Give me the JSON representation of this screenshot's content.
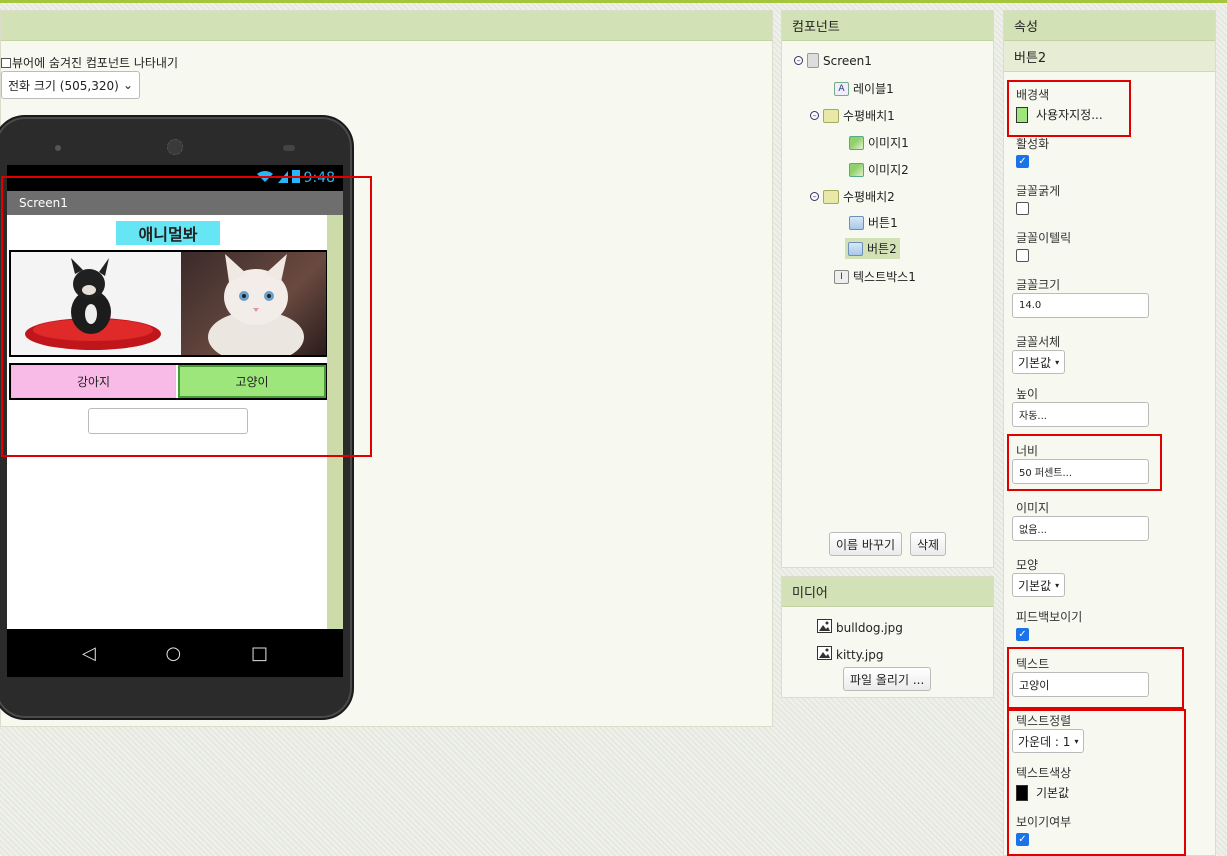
{
  "viewer": {
    "show_hidden_label": "뷰어에 숨겨진 컴포넌트 나타내기",
    "size_select_value": "전화 크기 (505,320)"
  },
  "phone": {
    "time": "9:48",
    "screen_title": "Screen1",
    "app_title": "애니멀봐",
    "button_dog": "강아지",
    "button_cat": "고양이",
    "nav_back": "◁",
    "nav_home": "○",
    "nav_recent": "□"
  },
  "components": {
    "title": "컴포넌트",
    "items": [
      {
        "label": "Screen1"
      },
      {
        "label": "레이블1"
      },
      {
        "label": "수평배치1"
      },
      {
        "label": "이미지1"
      },
      {
        "label": "이미지2"
      },
      {
        "label": "수평배치2"
      },
      {
        "label": "버튼1"
      },
      {
        "label": "버튼2"
      },
      {
        "label": "텍스트박스1"
      }
    ],
    "rename_button": "이름 바꾸기",
    "delete_button": "삭제"
  },
  "media": {
    "title": "미디어",
    "files": [
      "bulldog.jpg",
      "kitty.jpg"
    ],
    "upload_button": "파일 올리기 ..."
  },
  "properties": {
    "title": "속성",
    "component": "버튼2",
    "bg_color_label": "배경색",
    "bg_color_value": "사용자지정...",
    "bg_color_hex": "#9de67c",
    "enabled_label": "활성화",
    "bold_label": "글꼴굵게",
    "italic_label": "글꼴이텔릭",
    "font_size_label": "글꼴크기",
    "font_size_value": "14.0",
    "font_face_label": "글꼴서체",
    "font_face_value": "기본값",
    "height_label": "높이",
    "height_value": "자동...",
    "width_label": "너비",
    "width_value": "50 퍼센트...",
    "image_label": "이미지",
    "image_value": "없음...",
    "shape_label": "모양",
    "shape_value": "기본값",
    "feedback_label": "피드백보이기",
    "text_label": "텍스트",
    "text_value": "고양이",
    "text_align_label": "텍스트정렬",
    "text_align_value": "가운데 : 1",
    "text_color_label": "텍스트색상",
    "text_color_value": "기본값",
    "text_color_hex": "#000000",
    "visible_label": "보이기여부"
  }
}
